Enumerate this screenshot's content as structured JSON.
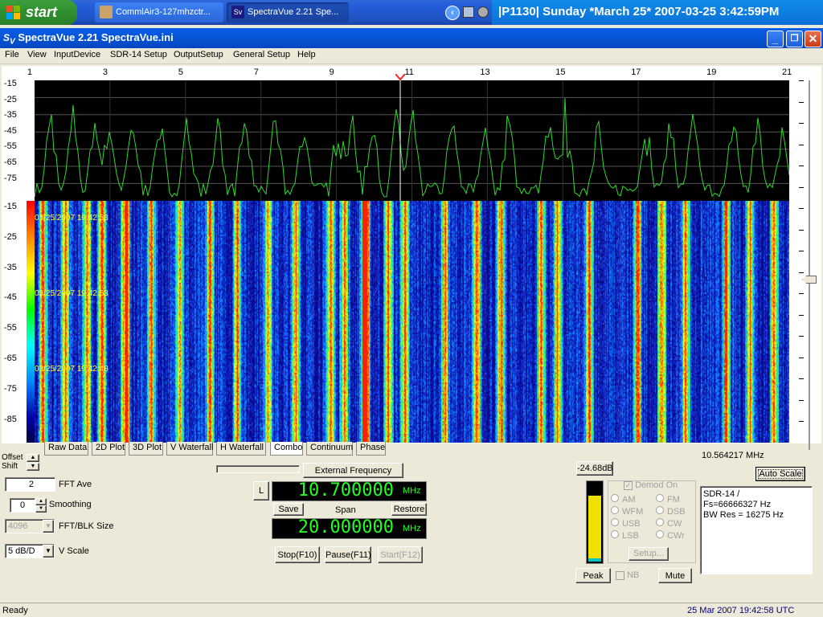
{
  "taskbar": {
    "start_label": "start",
    "tasks": [
      {
        "label": "CommlAir3-127mhzctr..."
      },
      {
        "label": "SpectraVue 2.21  Spe..."
      }
    ],
    "clock": "|P1130|  Sunday  *March 25* 2007-03-25  3:42:59PM"
  },
  "window": {
    "title": "SpectraVue 2.21  SpectraVue.ini",
    "minimize": "_",
    "restore": "❐",
    "close": "✕"
  },
  "menu": [
    "File",
    "View",
    "InputDevice",
    "SDR-14 Setup",
    "OutputSetup",
    "General Setup",
    "Help"
  ],
  "plot": {
    "x_ticks": [
      "1",
      "3",
      "5",
      "7",
      "9",
      "11",
      "13",
      "15",
      "17",
      "19",
      "21"
    ],
    "spectrum_y_ticks": [
      "-15",
      "-25",
      "-35",
      "-45",
      "-55",
      "-65",
      "-75"
    ],
    "waterfall_y_ticks": [
      "-15",
      "-25",
      "-35",
      "-45",
      "-55",
      "-65",
      "-75",
      "-85"
    ],
    "timestamps": [
      "03/25/2007 19:42:58",
      "03/25/2007 19:42:53",
      "03/25/2007 19:42:48"
    ],
    "cursor_freq": "10.564217 MHz",
    "colors": {
      "trace": "#2fd82f",
      "grid": "#606060",
      "marker": "#ff2020"
    }
  },
  "tabs": [
    "Raw Data",
    "2D Plot",
    "3D Plot",
    "V Waterfall",
    "H Waterfall",
    "Combo",
    "Continuum",
    "Phase"
  ],
  "active_tab": "Combo",
  "controls": {
    "offset_label": "Offset",
    "shift_label": "Shift",
    "fft_ave_value": "2",
    "fft_ave_label": "FFT Ave",
    "smoothing_value": "0",
    "smoothing_label": "Smoothing",
    "fft_size_value": "4096",
    "fft_size_label": "FFT/BLK Size",
    "vscale_value": "5 dB/D",
    "vscale_label": "V Scale",
    "external_freq": "External Frequency",
    "l_button": "L",
    "center_freq": "10.700000",
    "center_unit": "MHz",
    "save": "Save",
    "span_label": "Span",
    "restore": "Restore",
    "span_freq": "20.000000",
    "span_unit": "MHz",
    "stop": "Stop(F10)",
    "pause": "Pause(F11)",
    "start": "Start(F12)",
    "level": "-24.68dB",
    "auto_scale": "Auto Scale",
    "demod_on": "Demod On",
    "modes_left": [
      "AM",
      "WFM",
      "USB",
      "LSB"
    ],
    "modes_right": [
      "FM",
      "DSB",
      "CW",
      "CWr"
    ],
    "setup": "Setup...",
    "peak": "Peak",
    "nb": "NB",
    "mute": "Mute",
    "info": [
      "SDR-14  /",
      "Fs=66666327 Hz",
      "BW Res = 16275 Hz"
    ]
  },
  "status": {
    "left": "Ready",
    "right": "25 Mar 2007  19:42:58 UTC"
  }
}
